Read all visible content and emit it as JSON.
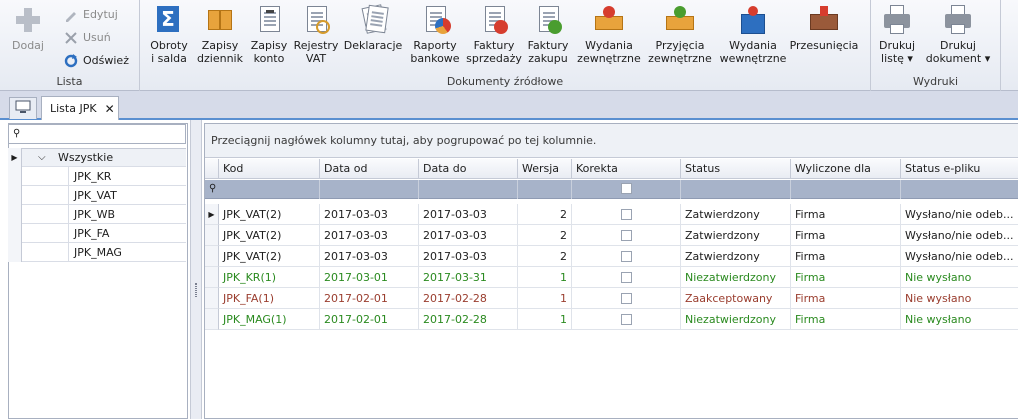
{
  "ribbon": {
    "lista": {
      "label": "Lista",
      "dodaj": "Dodaj",
      "edytuj": "Edytuj",
      "usun": "Usuń",
      "odswiez": "Odśwież"
    },
    "dokumenty": {
      "label": "Dokumenty źródłowe",
      "buttons": [
        {
          "label": "Obroty\ni salda"
        },
        {
          "label": "Zapisy\ndziennik"
        },
        {
          "label": "Zapisy\nkonto"
        },
        {
          "label": "Rejestry\nVAT"
        },
        {
          "label": "Deklaracje"
        },
        {
          "label": "Raporty\nbankowe"
        },
        {
          "label": "Faktury\nsprzedaży"
        },
        {
          "label": "Faktury\nzakupu"
        },
        {
          "label": "Wydania\nzewnętrzne"
        },
        {
          "label": "Przyjęcia\nzewnętrzne"
        },
        {
          "label": "Wydania\nwewnętrzne"
        },
        {
          "label": "Przesunięcia"
        }
      ]
    },
    "wydruki": {
      "label": "Wydruki",
      "drukuj_liste": "Drukuj\nlistę ▾",
      "drukuj_dokument": "Drukuj\ndokument ▾"
    }
  },
  "tabs": {
    "active": "Lista JPK",
    "close": "✕"
  },
  "tree": {
    "root": "Wszystkie",
    "items": [
      "JPK_KR",
      "JPK_VAT",
      "JPK_WB",
      "JPK_FA",
      "JPK_MAG"
    ]
  },
  "grid": {
    "group_hint": "Przeciągnij nagłówek kolumny tutaj, aby pogrupować po tej kolumnie.",
    "columns": [
      "Kod",
      "Data od",
      "Data do",
      "Wersja",
      "Korekta",
      "Status",
      "Wyliczone dla",
      "Status e-pliku"
    ],
    "rows": [
      {
        "kod": "JPK_VAT(2)",
        "od": "2017-03-03",
        "do": "2017-03-03",
        "wersja": "2",
        "status": "Zatwierdzony",
        "dla": "Firma",
        "eplik": "Wysłano/nie odeb...",
        "color": "normal"
      },
      {
        "kod": "JPK_VAT(2)",
        "od": "2017-03-03",
        "do": "2017-03-03",
        "wersja": "2",
        "status": "Zatwierdzony",
        "dla": "Firma",
        "eplik": "Wysłano/nie odeb...",
        "color": "normal"
      },
      {
        "kod": "JPK_VAT(2)",
        "od": "2017-03-03",
        "do": "2017-03-03",
        "wersja": "2",
        "status": "Zatwierdzony",
        "dla": "Firma",
        "eplik": "Wysłano/nie odeb...",
        "color": "normal"
      },
      {
        "kod": "JPK_KR(1)",
        "od": "2017-03-01",
        "do": "2017-03-31",
        "wersja": "1",
        "status": "Niezatwierdzony",
        "dla": "Firma",
        "eplik": "Nie wysłano",
        "color": "green"
      },
      {
        "kod": "JPK_FA(1)",
        "od": "2017-02-01",
        "do": "2017-02-28",
        "wersja": "1",
        "status": "Zaakceptowany",
        "dla": "Firma",
        "eplik": "Nie wysłano",
        "color": "red"
      },
      {
        "kod": "JPK_MAG(1)",
        "od": "2017-02-01",
        "do": "2017-02-28",
        "wersja": "1",
        "status": "Niezatwierdzony",
        "dla": "Firma",
        "eplik": "Nie wysłano",
        "color": "green"
      }
    ]
  }
}
